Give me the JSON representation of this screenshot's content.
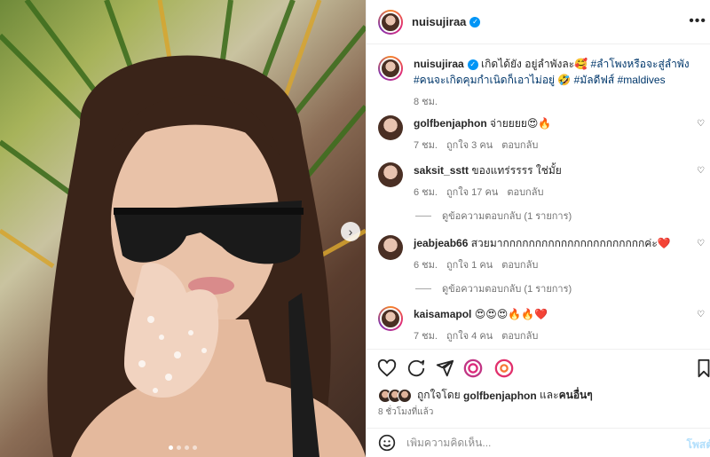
{
  "post": {
    "username": "nuisujiraa",
    "caption_text": "เกิดได้ยัง อยู่ลำพังละ🥰",
    "hashtags": "#ลำโพงหรือจะสู่ลำพัง #คนจะเกิดคุมกำเนิดก็เอาไม่อยู่ 🤣 #มัลดีฟส์ #maldives",
    "caption_time": "8 ชม."
  },
  "comments": [
    {
      "username": "golfbenjaphon",
      "text": "จ่ายยยย😍🔥",
      "time": "7 ชม.",
      "likes": "ถูกใจ 3 คน",
      "reply": "ตอบกลับ"
    },
    {
      "username": "saksit_sstt",
      "text": "ของแทร่รรรร ใช่มั้ย",
      "time": "6 ชม.",
      "likes": "ถูกใจ 17 คน",
      "reply": "ตอบกลับ",
      "view_replies": "ดูข้อความตอบกลับ (1 รายการ)"
    },
    {
      "username": "jeabjeab66",
      "text": "สวยมากกกกกกกกกกกกกกกกกกกกกกค่ะ❤️",
      "time": "6 ชม.",
      "likes": "ถูกใจ 1 คน",
      "reply": "ตอบกลับ",
      "view_replies": "ดูข้อความตอบกลับ (1 รายการ)"
    },
    {
      "username": "kaisamapol",
      "text": "😍😍😍🔥🔥❤️",
      "time": "7 ชม.",
      "likes": "ถูกใจ 4 คน",
      "reply": "ตอบกลับ"
    }
  ],
  "likes_summary": {
    "prefix": "ถูกใจโดย",
    "user": "golfbenjaphon",
    "joiner": "และ",
    "others": "คนอื่นๆ"
  },
  "posted_time": "8 ชั่วโมงที่แล้ว",
  "add_comment": {
    "placeholder": "เพิ่มความคิดเห็น...",
    "post_label": "โพสต์"
  },
  "media": {
    "slide_count": 4,
    "active_slide": 1
  },
  "icons": {
    "more": "more-icon",
    "like": "heart-icon",
    "comment": "comment-icon",
    "share": "share-icon",
    "save": "bookmark-icon",
    "emoji": "emoji-icon",
    "next": "chevron-right-icon"
  },
  "colors": {
    "verified": "#0095f6",
    "hashtag": "#00376b",
    "post_button_disabled": "#b2dffc"
  }
}
